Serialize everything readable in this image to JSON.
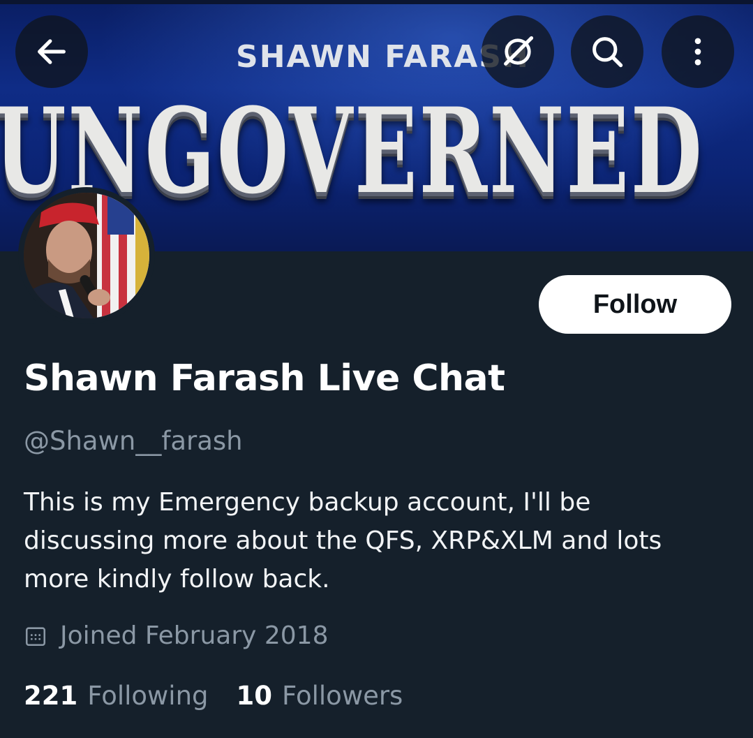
{
  "banner": {
    "subtitle": "SHAWN FARASH",
    "title": "UNGOVERNED"
  },
  "toolbar": {
    "back_icon": "arrow-left-icon",
    "grok_icon": "slash-circle-icon",
    "search_icon": "search-icon",
    "more_icon": "more-vertical-icon"
  },
  "profile": {
    "display_name": "Shawn Farash Live Chat",
    "handle": "@Shawn__farash",
    "bio": "This is my Emergency backup account, I'll be discussing more about the QFS, XRP&XLM and lots more kindly follow back.",
    "joined": "Joined February 2018",
    "follow_label": "Follow"
  },
  "stats": {
    "following_count": "221",
    "following_label": "Following",
    "followers_count": "10",
    "followers_label": "Followers"
  },
  "colors": {
    "background": "#15202b",
    "muted_text": "#8b98a5",
    "banner_blue": "#0f2c86"
  }
}
